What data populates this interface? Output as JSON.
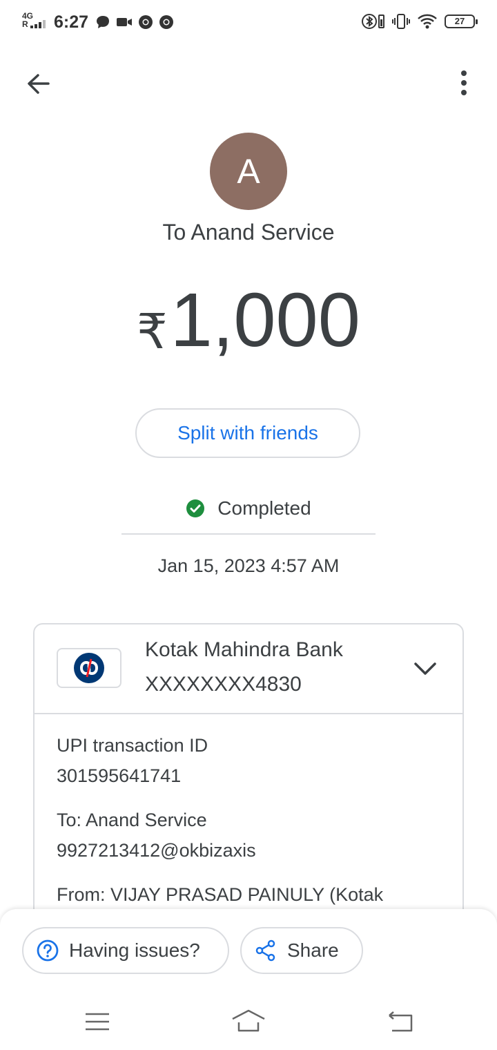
{
  "status_bar": {
    "network": "4G",
    "roaming": "R",
    "time": "6:27",
    "battery": "27",
    "left_icons": [
      "message-icon",
      "video-icon",
      "chrome-icon",
      "chrome-icon"
    ],
    "right_icons": [
      "bluetooth-icon",
      "vibrate-icon",
      "wifi-icon",
      "battery-icon"
    ]
  },
  "header": {
    "avatar_letter": "A",
    "avatar_color": "#8d6e63",
    "recipient": "To Anand Service",
    "currency_symbol": "₹",
    "amount": "1,000"
  },
  "actions": {
    "split_label": "Split with friends"
  },
  "status": {
    "label": "Completed",
    "color": "#1e8e3e",
    "datetime": "Jan 15, 2023 4:57 AM"
  },
  "bank": {
    "name": "Kotak Mahindra Bank",
    "account": "XXXXXXXX4830"
  },
  "details": {
    "txn_label": "UPI transaction ID",
    "txn_id": "301595641741",
    "to_label": "To: Anand Service",
    "to_upi": "9927213412@okbizaxis",
    "from_label": "From: VIJAY PRASAD PAINULY (Kotak"
  },
  "bottom": {
    "issues_label": "Having issues?",
    "share_label": "Share"
  },
  "accent_color": "#1a73e8"
}
